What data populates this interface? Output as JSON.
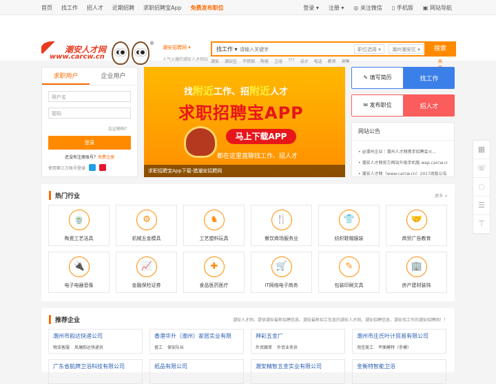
{
  "topbar": {
    "nav": [
      "首页",
      "找工作",
      "招人才",
      "近期招聘",
      "求职招聘宝App",
      "免费发布职位"
    ],
    "right": [
      "登录 ▾",
      "注册 ▾",
      "关注微信",
      "手机版",
      "网站导航"
    ]
  },
  "header": {
    "logo_cn": "潮安人才网",
    "logo_url": "www.carcw.cn",
    "reg": "®",
    "site": "潮安招聘网",
    "slogan": "人气火爆的潮安人才网站"
  },
  "search": {
    "type": "找工作",
    "placeholder": "请输入关键字",
    "job_select": "职位选择",
    "area_select": "潮州潮安区",
    "button": "搜索",
    "hotwords": [
      "潮安",
      "潮安区",
      "不锈钢",
      "陶瓷",
      "卫浴",
      "???",
      "设计",
      "电话",
      "教师",
      "销售"
    ],
    "advanced": "高级搜索"
  },
  "login": {
    "tabs": [
      "求职用户",
      "企业用户"
    ],
    "user_placeholder": "用户名",
    "pwd_placeholder": "密码",
    "forgot": "忘记密码？",
    "button": "登录",
    "register": "还没有注册账号？",
    "register_link": "免费注册",
    "third": "使用第三方账号登录"
  },
  "banner": {
    "l1a": "找",
    "l1b": "附近",
    "l1c": "工作、招",
    "l1d": "附近",
    "l1e": "人才",
    "l2": "求职招聘宝APP",
    "button": "马上下载APP",
    "l3": "都在这里直聊找工作、招人才",
    "caption": "求职招聘宝App下载-猎潮安招聘网"
  },
  "cards": [
    {
      "l": "填写简历",
      "r": "找工作"
    },
    {
      "l": "发布职位",
      "r": "招人才"
    }
  ],
  "notice": {
    "title": "网站公告",
    "items": [
      "• @潮州企业｜潮州人才网携手招聘会火...",
      "• 潮安人才网官方网站升级手机版 wap.carcw.cn",
      "• 潮安人才网（www.carcw.cn）2017改版公告"
    ]
  },
  "industry": {
    "title": "热门行业",
    "more": "更多 >",
    "items": [
      {
        "t": "陶瓷工艺洁具",
        "ic": "teapot-icon",
        "g": "🍵"
      },
      {
        "t": "机械五金模具",
        "ic": "gear-icon",
        "g": "⚙"
      },
      {
        "t": "工艺塑料玩具",
        "ic": "horse-icon",
        "g": "♞"
      },
      {
        "t": "餐饮商场服务业",
        "ic": "utensils-icon",
        "g": "🍴"
      },
      {
        "t": "纺织鞋帽服装",
        "ic": "shirt-icon",
        "g": "👕"
      },
      {
        "t": "商贸广告教育",
        "ic": "handshake-icon",
        "g": "🤝"
      },
      {
        "t": "电子电器音像",
        "ic": "plug-icon",
        "g": "🔌"
      },
      {
        "t": "金融保险证券",
        "ic": "chart-icon",
        "g": "📈"
      },
      {
        "t": "食品医药医疗",
        "ic": "medkit-icon",
        "g": "✚"
      },
      {
        "t": "IT网络电子商务",
        "ic": "cart-icon",
        "g": "🛒"
      },
      {
        "t": "包装印刷文具",
        "ic": "pen-icon",
        "g": "✎"
      },
      {
        "t": "房产建材装饰",
        "ic": "building-icon",
        "g": "🏢"
      }
    ]
  },
  "companies": {
    "title": "推荐企业",
    "desc": "潮安人才网，提供潮安最新招聘信息，潮安最新招工信息的潮安人才网，潮安招聘信息，潮安找工作的潮安招聘网！！",
    "items": [
      {
        "n": "潮州市韵达快递公司",
        "j": [
          "物流客服",
          "风塘韵达快递员"
        ]
      },
      {
        "n": "香港华升（潮州）家居实业有限",
        "j": [
          "普工",
          "保安队长"
        ]
      },
      {
        "n": "神彩五金厂",
        "j": [
          "外贸跟单",
          "外贸业务员"
        ]
      },
      {
        "n": "潮州市庄氏叶计贸易有限公司",
        "j": [
          "淘宝美工",
          "平面模特（手模）"
        ]
      },
      {
        "n": "广东省航牌卫浴科技有限公司",
        "j": []
      },
      {
        "n": "纸品有限公司",
        "j": []
      },
      {
        "n": "潮安精智五金实业有限公司",
        "j": []
      },
      {
        "n": "金衡特智能卫浴",
        "j": []
      }
    ]
  }
}
